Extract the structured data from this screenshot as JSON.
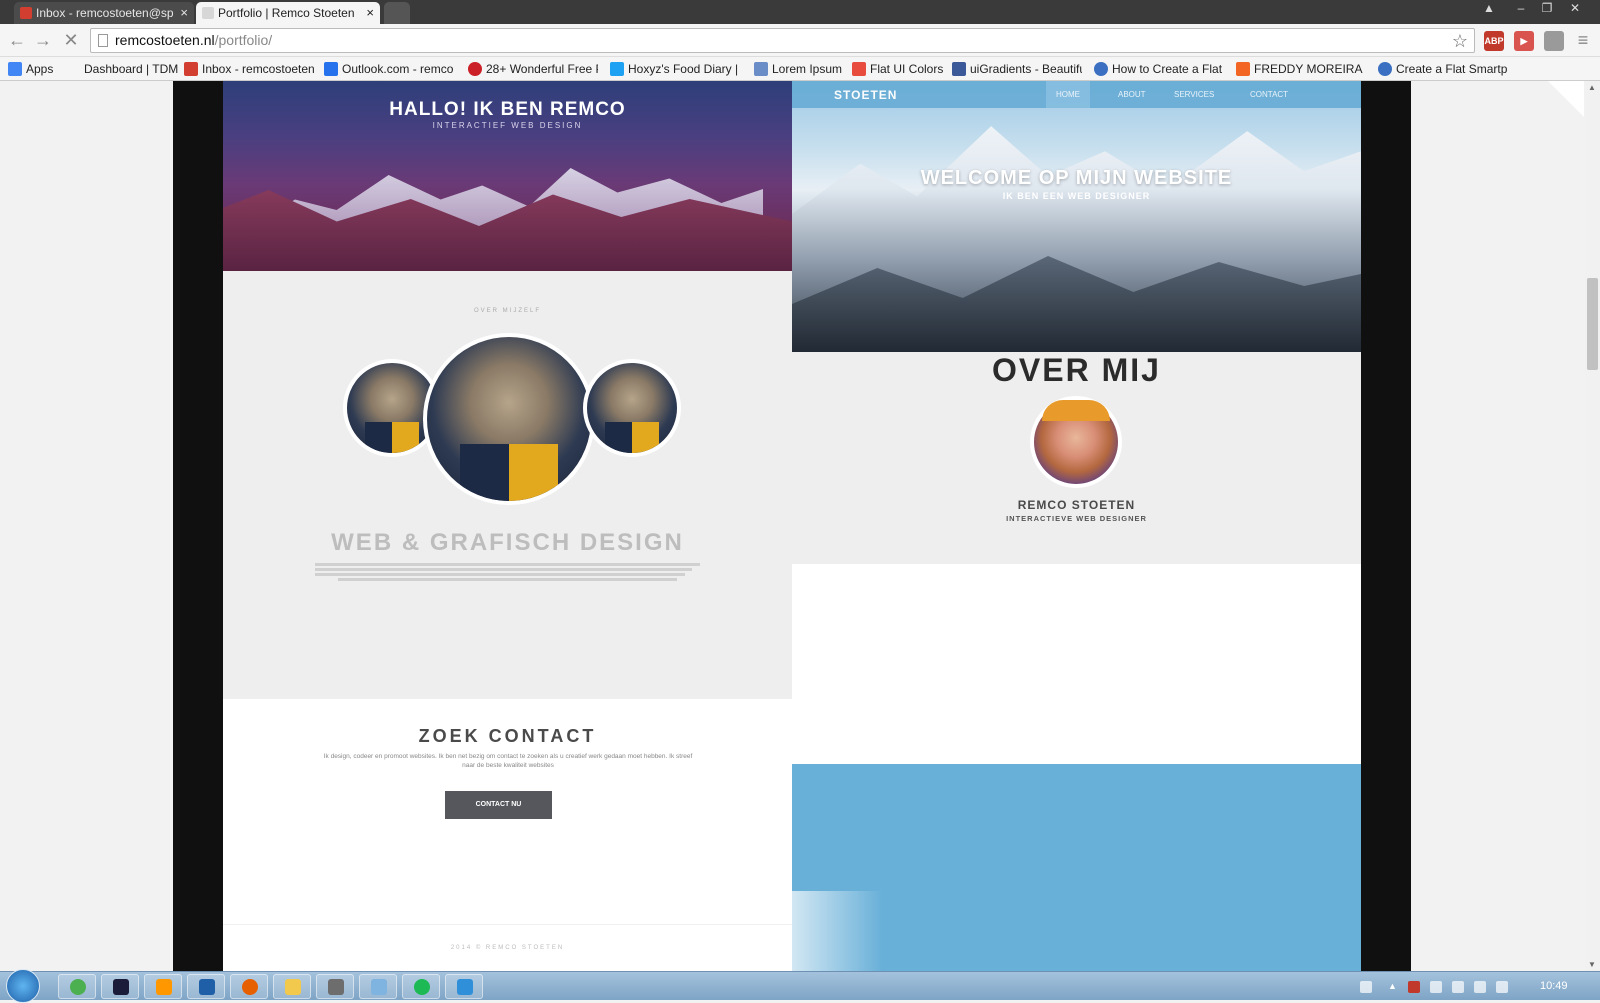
{
  "browser": {
    "tabs": [
      {
        "title": "Inbox - remcostoeten@sp",
        "active": false,
        "favicon_color": "#d23f31"
      },
      {
        "title": "Portfolio | Remco Stoeten",
        "active": true,
        "favicon_color": "#888888"
      }
    ],
    "url_host": "remcostoeten.nl",
    "url_path": "/portfolio/",
    "extensions": [
      {
        "name": "adblock-icon",
        "label": "ABP",
        "color": "#c0392b"
      },
      {
        "name": "youtube-icon",
        "label": "▶",
        "color": "#d9534f"
      },
      {
        "name": "extension-icon",
        "label": "",
        "color": "#9a9a9a"
      }
    ],
    "bookmarks": [
      {
        "label": "Apps",
        "color": "#4285f4"
      },
      {
        "label": "Dashboard | TDM",
        "color": "#f5f5f5"
      },
      {
        "label": "Inbox - remcostoeten",
        "color": "#d23f31"
      },
      {
        "label": "Outlook.com - remco",
        "color": "#2672ec"
      },
      {
        "label": "28+ Wonderful Free P",
        "color": "#cb2027"
      },
      {
        "label": "Hoxyz's Food Diary | N",
        "color": "#1da1f2"
      },
      {
        "label": "Lorem Ipsum",
        "color": "#6a8cc7"
      },
      {
        "label": "Flat UI Colors",
        "color": "#e74c3c"
      },
      {
        "label": "uiGradients - Beautifu",
        "color": "#3b5998"
      },
      {
        "label": "How to Create a Flat",
        "color": "#3a6fc1"
      },
      {
        "label": "FREDDY MOREIRA - N",
        "color": "#f26522"
      },
      {
        "label": "Create a Flat Smartph",
        "color": "#3a6fc1"
      }
    ]
  },
  "left_design": {
    "hero_title": "HALLO! IK BEN REMCO",
    "hero_subtitle": "INTERACTIEF WEB DESIGN",
    "about_small": "OVER MIJZELF",
    "heading": "WEB & GRAFISCH DESIGN",
    "contact_title": "ZOEK CONTACT",
    "contact_text": "Ik design, codeer en promoot websites. Ik ben net bezig om contact te zoeken als u creatief werk gedaan moet hebben. Ik streef naar de beste kwaliteit websites",
    "contact_button": "CONTACT NU",
    "footer": "2014 © REMCO STOETEN"
  },
  "right_design": {
    "brand": "STOETEN",
    "nav": [
      "HOME",
      "ABOUT",
      "SERVICES",
      "CONTACT"
    ],
    "nav_active": "HOME",
    "welcome": "WELCOME OP MIJN WEBSITE",
    "welcome_sub": "IK BEN EEN WEB DESIGNER",
    "about_title": "OVER MIJ",
    "name": "REMCO STOETEN",
    "role": "INTERACTIEVE WEB DESIGNER"
  },
  "taskbar": {
    "clock": "10:49",
    "apps": [
      {
        "name": "chrome-icon",
        "color": "#4caf50"
      },
      {
        "name": "batman-icon",
        "color": "#1b1b3a"
      },
      {
        "name": "sublime-icon",
        "color": "#ff9800"
      },
      {
        "name": "photoshop-icon",
        "color": "#1e5fa8"
      },
      {
        "name": "firefox-icon",
        "color": "#e66000"
      },
      {
        "name": "explorer-icon",
        "color": "#f2c94c"
      },
      {
        "name": "calculator-icon",
        "color": "#6d6d6d"
      },
      {
        "name": "paint-icon",
        "color": "#7fb3e0"
      },
      {
        "name": "spotify-icon",
        "color": "#1db954"
      },
      {
        "name": "lync-icon",
        "color": "#2f8fd8"
      }
    ]
  },
  "colors": {
    "accent_blue": "#69b0d8",
    "dark_button": "#55575c"
  }
}
